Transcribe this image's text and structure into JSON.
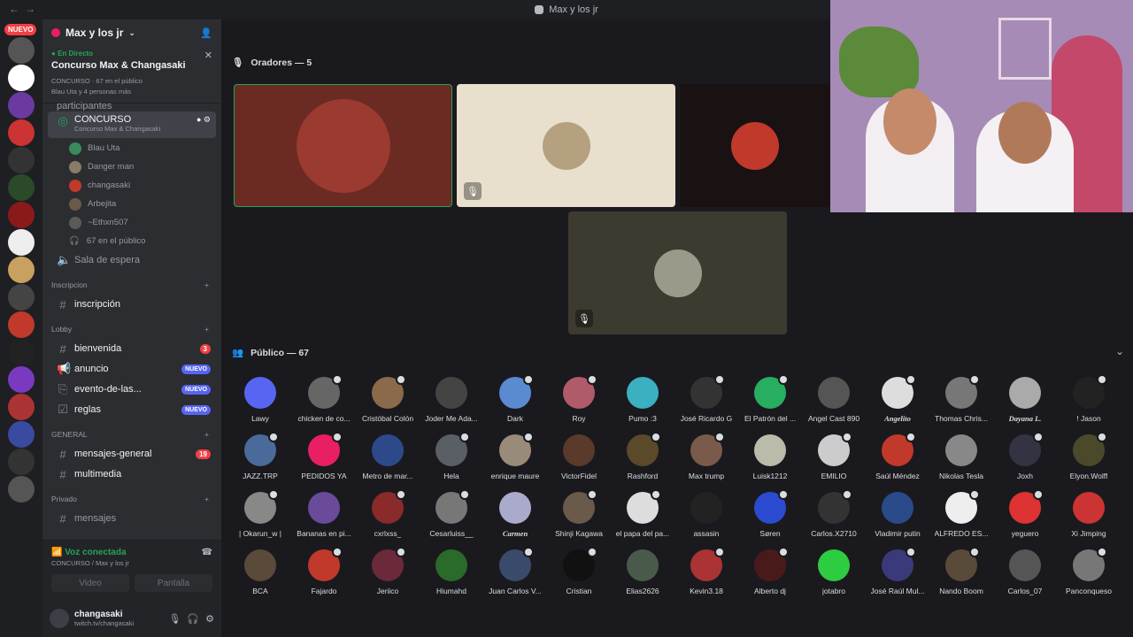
{
  "window": {
    "title": "Max y los jr"
  },
  "server": {
    "name": "Max y los jr",
    "nuevo": "NUEVO"
  },
  "live": {
    "status": "En Directo",
    "name": "Concurso Max & Changasaki",
    "meta": "CONCURSO · 67 en el público",
    "people": "Blau Uta y 4 personas más"
  },
  "channels": {
    "participantes": "participantes",
    "concurso": {
      "name": "CONCURSO",
      "sub": "Concurso Max & Changasaki"
    },
    "voice_users": [
      {
        "name": "Blau Uta",
        "color": "#3a8a5a"
      },
      {
        "name": "Danger man",
        "color": "#8a7a6a"
      },
      {
        "name": "changasaki",
        "color": "#c0392b"
      },
      {
        "name": "Arbejita",
        "color": "#6a5a4a"
      },
      {
        "name": "~Ethxn507",
        "color": "#5a5a5a"
      }
    ],
    "publico": "67 en el público",
    "sala": "Sala de espera",
    "cat_inscripcion": "Inscripcion",
    "inscripcion": "inscripción",
    "cat_lobby": "Lobby",
    "bienvenida": "bienvenida",
    "bienvenida_badge": "3",
    "anuncio": "anuncio",
    "evento": "evento-de-las...",
    "reglas": "reglas",
    "nuevo": "NUEVO",
    "cat_general": "GENERAL",
    "mensajes_general": "mensajes-general",
    "mg_badge": "19",
    "multimedia": "multimedia",
    "cat_privado": "Privado",
    "mensajes": "mensajes"
  },
  "voice": {
    "status": "Voz conectada",
    "sub": "CONCURSO / Max y los jr",
    "video": "Video",
    "screen": "Pantalla"
  },
  "user": {
    "name": "changasaki",
    "status": "twitch.tv/changasaki"
  },
  "stage": {
    "speakers_label": "Oradores — 5",
    "audience_label": "Público — 67"
  },
  "audience": [
    [
      "Lawy",
      "chicken de co...",
      "Cristóbal Colón",
      "Joder Me Ada...",
      "Dark",
      "Roy",
      "Pumo :3",
      "José Ricardo G",
      "El Patrón del ...",
      "Angel Cast 890",
      "Angelito",
      "Thomas Chris...",
      "Dayana L.",
      "! Jason"
    ],
    [
      "JAZZ.TRP",
      "PEDIDOS YA",
      "Metro de mar...",
      "Hela",
      "enrique maure",
      "VictorFidel",
      "Rashford",
      "Max trump",
      "Luisk1212",
      "EMILIO",
      "Saúl Méndez",
      "Nikolas Tesla",
      "Joxh",
      "Elyon.Wolff"
    ],
    [
      "| Okarun_w |",
      "Bananas en pi...",
      "cxrlxss_",
      "Cesarluiss__",
      "Carmen",
      "Shinji Kagawa",
      "el papa del pa...",
      "assasin",
      "Søren",
      "Carlos.X2710",
      "Vladimir putin",
      "ALFREDO ES...",
      "yeguero",
      "Xi Jimping"
    ],
    [
      "BCA",
      "Fajardo",
      "Jeriico",
      "Hiumahd",
      "Juan Carlos V...",
      "Cristian",
      "Elias2626",
      "Kevin3.18",
      "Alberto dj",
      "jotabro",
      "José Raúl Mul...",
      "Nando Boom",
      "Carlos_07",
      "Panconqueso"
    ]
  ],
  "audience_colors": [
    [
      "#5865f2",
      "#666",
      "#8a6a4a",
      "#444",
      "#5a8ad0",
      "#b05a6a",
      "#3ab0c0",
      "#333",
      "#27ae60",
      "#555",
      "#ddd",
      "#777",
      "#aaa",
      "#222"
    ],
    [
      "#4a6a9a",
      "#e91e63",
      "#2c4a8a",
      "#5a5f66",
      "#9a8a7a",
      "#5a3a2a",
      "#5a4a2a",
      "#7a5a4a",
      "#bba",
      "#ccc",
      "#c0392b",
      "#888",
      "#334",
      "#4a4a2a"
    ],
    [
      "#888",
      "#6a4a9a",
      "#8a2a2a",
      "#777",
      "#aac",
      "#6a5a4a",
      "#ddd",
      "#222",
      "#2a4ad0",
      "#333",
      "#2a4a8a",
      "#eee",
      "#d33",
      "#c33"
    ],
    [
      "#5a4a3a",
      "#c0392b",
      "#6a2a3a",
      "#2a6a2a",
      "#3a4a6a",
      "#111",
      "#4a5a4a",
      "#a33",
      "#4a1a1a",
      "#2ecc40",
      "#3a3a7a",
      "#5a4a3a",
      "#555",
      "#777"
    ]
  ],
  "italic_names": [
    "Angelito",
    "Dayana L.",
    "Carmen"
  ],
  "speakers": [
    {
      "bg": "#6b2a22",
      "av": "#9b3a30"
    },
    {
      "bg": "#e8e0cc",
      "av": "#b5a080"
    },
    {
      "bg": "#1a1212",
      "av": "#c0392b"
    },
    {
      "bg": "#3d3b2f",
      "av": "#9a9a8a"
    }
  ]
}
